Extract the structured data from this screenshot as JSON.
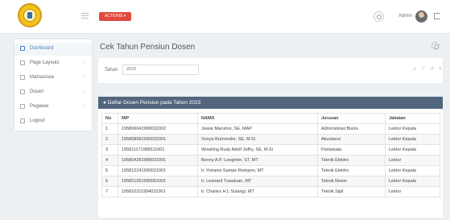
{
  "topbar": {
    "actions_label": "ACTIONS ▾",
    "user_name": "Admin"
  },
  "sidebar": {
    "items": [
      {
        "label": "Dashboard"
      },
      {
        "label": "Page Layouts"
      },
      {
        "label": "Mahasiswa"
      },
      {
        "label": "Dosen"
      },
      {
        "label": "Pegawai"
      },
      {
        "label": "Logout"
      }
    ]
  },
  "main": {
    "title": "Cek Tahun Pensiun Dosen",
    "filter": {
      "label": "Tahun",
      "value": "2023",
      "tools": "∨ ↗ ↺ ✕"
    },
    "table": {
      "heading": "Daftar Dosen Pensiun pada Tahun 2023",
      "columns": [
        "No",
        "NIP",
        "NAMA",
        "Jurusan",
        "Jabatan"
      ],
      "rows": [
        [
          "1",
          "195806041989032002",
          "Jeane Marumis, SE, MAP",
          "Administrasi Bisnis",
          "Lektor Kepala"
        ],
        [
          "2",
          "195808081990032001",
          "Sonya Rumondor, SE, M.Si",
          "Akuntansi",
          "Lektor Kepala"
        ],
        [
          "3",
          "195811171988111001",
          "Wowiling Rudy Adolf Jeffry, SE, M.Si",
          "Pariwisata",
          "Lektor Kepala"
        ],
        [
          "4",
          "195804281988031001",
          "Benny A.P. Loegimin, ST, MT",
          "Teknik Elektro",
          "Lektor"
        ],
        [
          "5",
          "195812241990031001",
          "Ir. Yohanis Sampe Rompon, MT",
          "Teknik Elektro",
          "Lektor Kepala"
        ],
        [
          "6",
          "195801051990091001",
          "Ir. Leonard Tuwaluan, MT",
          "Teknik Mesin",
          "Lektor Kepala"
        ],
        [
          "7",
          "195810311994031001",
          "Ir. Charles H.L Sulangi, MT",
          "Teknik Sipil",
          "Lektor"
        ]
      ]
    }
  }
}
